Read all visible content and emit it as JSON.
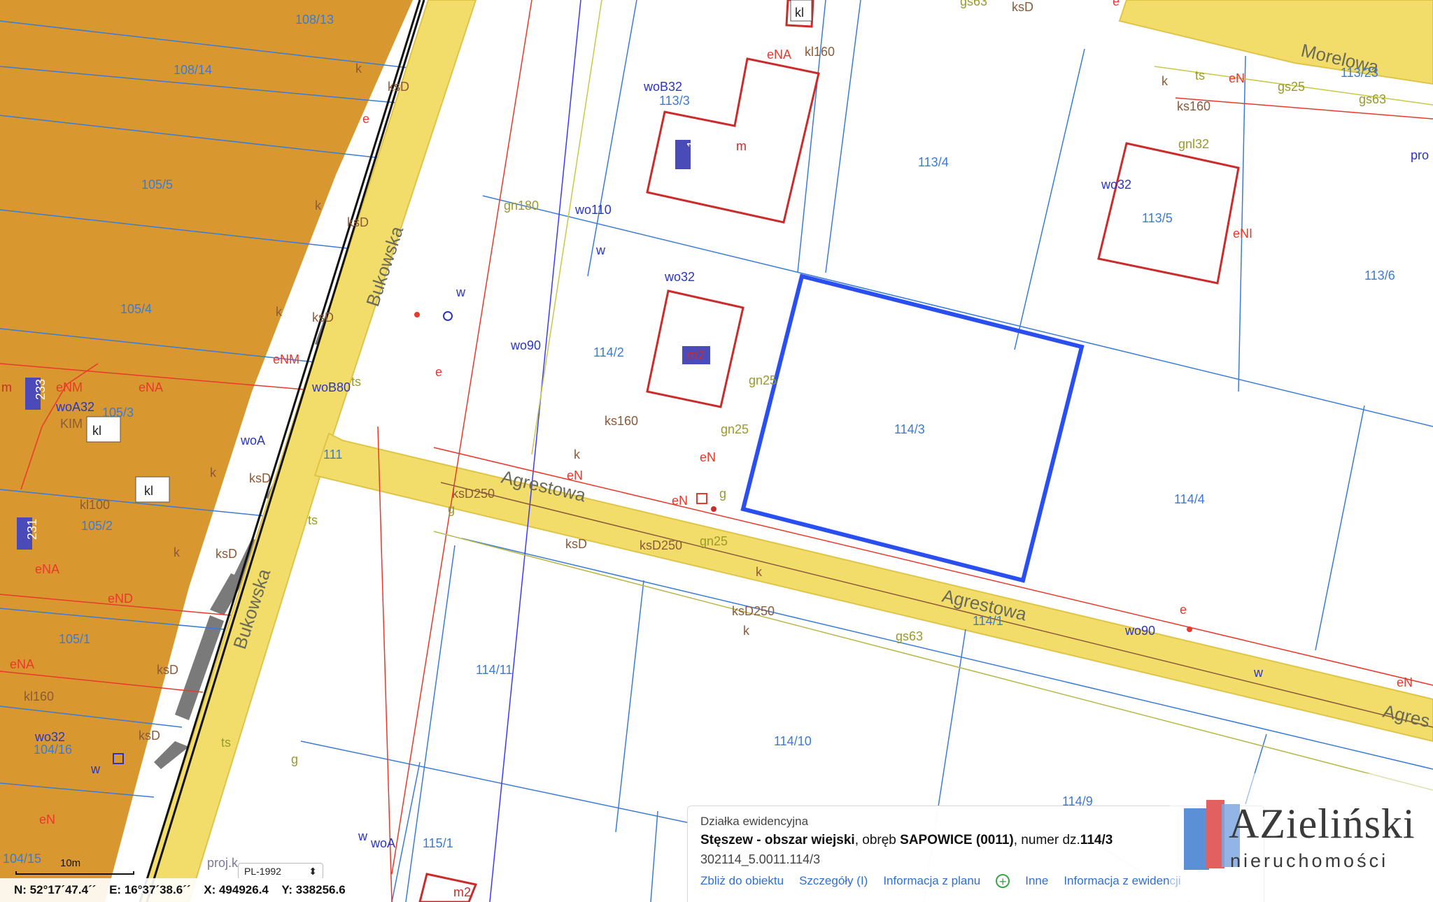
{
  "streets": [
    {
      "name": "Bukowska",
      "id": "bukowska-1"
    },
    {
      "name": "Bukowska",
      "id": "bukowska-2"
    },
    {
      "name": "Agrestowa",
      "id": "agrestowa-1"
    },
    {
      "name": "Agrestowa",
      "id": "agrestowa-2"
    },
    {
      "name": "Agres",
      "id": "agrestowa-3"
    },
    {
      "name": "Morelowa",
      "id": "morelowa"
    }
  ],
  "parcels": [
    "108/13",
    "108/14",
    "105/5",
    "105/4",
    "105/3",
    "105/2",
    "105/1",
    "104/16",
    "104/15",
    "113/3",
    "113/4",
    "113/5",
    "113/6",
    "113/23",
    "114/2",
    "114/3",
    "114/4",
    "114/1",
    "114/11",
    "114/10",
    "114/9",
    "115/1",
    "111"
  ],
  "building_numbers": [
    "164",
    "233",
    "231"
  ],
  "utility_labels": {
    "red": [
      "eNA",
      "eNA",
      "eNA",
      "eNA",
      "eND",
      "eNM",
      "eNM",
      "eN",
      "eN",
      "eN",
      "eN",
      "eN",
      "eN",
      "eNI",
      "e",
      "e",
      "e",
      "e"
    ],
    "blue": [
      "woB32",
      "wo110",
      "wo32",
      "wo90",
      "wo32",
      "woA32",
      "woA",
      "woB80",
      "wo32",
      "wo90",
      "woA",
      "w",
      "w",
      "w",
      "w",
      "w"
    ],
    "brown": [
      "kl160",
      "ks160",
      "ks160",
      "ksD",
      "ksD",
      "ksD",
      "ksD",
      "ksD",
      "ksD",
      "ksD",
      "ksD250",
      "ksD250",
      "ksD250",
      "kl100",
      "kl160",
      "ksD",
      "ksD",
      "k",
      "k",
      "k",
      "k",
      "k",
      "k",
      "k",
      "k",
      "k"
    ],
    "olive": [
      "gs63",
      "gs63",
      "gs63",
      "gn180",
      "gn25",
      "gn25",
      "gn25",
      "gnl32",
      "gs25",
      "g",
      "g",
      "g",
      "ts",
      "ts",
      "ts",
      "ts"
    ],
    "misc": [
      "m",
      "m",
      "m",
      "m2",
      "m2",
      "kl",
      "kl",
      "kl",
      "KIM",
      "proj.k",
      "pro"
    ]
  },
  "info_panel": {
    "title": "Działka ewidencyjna",
    "location_bold": "Stęszew - obszar wiejski",
    "obreb_prefix": ", obręb ",
    "obreb_bold": "SAPOWICE (0011)",
    "numer_prefix": ", numer dz.",
    "numer_bold": "114/3",
    "identifier": "302114_5.0011.114/3",
    "links": [
      "Zbliż do obiektu",
      "Szczegóły (I)",
      "Informacja z planu",
      "Inne",
      "Informacja z ewidencji"
    ]
  },
  "logo": {
    "name": "AZieliński",
    "subtitle": "nieruchomości"
  },
  "scale_label": "10m",
  "crs": "PL-1992",
  "coordinates": {
    "n": "N: 52°17´47.4´´",
    "e": "E: 16°37´38.6´´",
    "x": "X: 494926.4",
    "y": "Y: 338256.6"
  },
  "colors": {
    "selected_parcel": "#2a4ff0",
    "parcel_line": "#3a7bd5",
    "road_fill": "#f3dd6a",
    "building": "#cc2b2b",
    "zone_fill": "#d9982f"
  }
}
